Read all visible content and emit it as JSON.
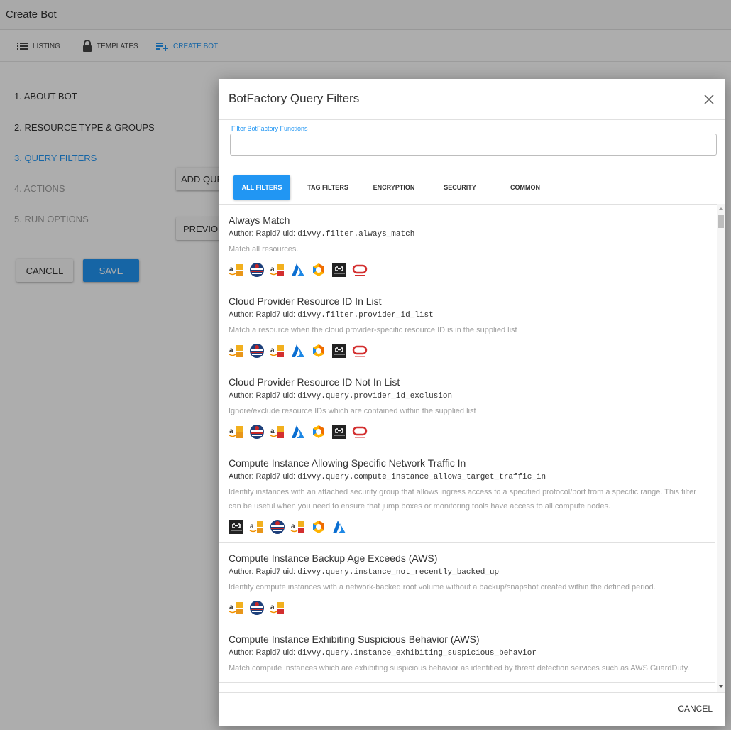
{
  "page": {
    "title": "Create Bot"
  },
  "nav": [
    {
      "label": "LISTING",
      "icon": "list-icon",
      "active": false
    },
    {
      "label": "TEMPLATES",
      "icon": "lock-icon",
      "active": false
    },
    {
      "label": "CREATE BOT",
      "icon": "playlist-add-icon",
      "active": true
    }
  ],
  "steps": [
    {
      "label": "1. ABOUT BOT",
      "state": "done"
    },
    {
      "label": "2. RESOURCE TYPE & GROUPS",
      "state": "done"
    },
    {
      "label": "3. QUERY FILTERS",
      "state": "current"
    },
    {
      "label": "4. ACTIONS",
      "state": "disabled"
    },
    {
      "label": "5. RUN OPTIONS",
      "state": "disabled"
    }
  ],
  "buttons": {
    "add_query": "ADD QUERY FILTER",
    "previous": "PREVIOUS",
    "cancel": "CANCEL",
    "save": "SAVE"
  },
  "modal": {
    "title": "BotFactory Query Filters",
    "filter_label": "Filter BotFactory Functions",
    "filter_value": "",
    "tabs": [
      "ALL FILTERS",
      "TAG FILTERS",
      "ENCRYPTION",
      "SECURITY",
      "COMMON"
    ],
    "active_tab": "ALL FILTERS",
    "footer_cancel": "CANCEL",
    "items": [
      {
        "title": "Always Match",
        "author": "Author: Rapid7",
        "uid_label": "uid:",
        "uid": "divvy.filter.always_match",
        "description": "Match all resources.",
        "icons": [
          "aws-icon",
          "aws-gov-icon",
          "aws-china-icon",
          "azure-icon",
          "gcp-icon",
          "alibaba-icon",
          "oracle-icon"
        ]
      },
      {
        "title": "Cloud Provider Resource ID In List",
        "author": "Author: Rapid7",
        "uid_label": "uid:",
        "uid": "divvy.filter.provider_id_list",
        "description": "Match a resource when the cloud provider-specific resource ID is in the supplied list",
        "icons": [
          "aws-icon",
          "aws-gov-icon",
          "aws-china-icon",
          "azure-icon",
          "gcp-icon",
          "alibaba-icon",
          "oracle-icon"
        ]
      },
      {
        "title": "Cloud Provider Resource ID Not In List",
        "author": "Author: Rapid7",
        "uid_label": "uid:",
        "uid": "divvy.query.provider_id_exclusion",
        "description": "Ignore/exclude resource IDs which are contained within the supplied list",
        "icons": [
          "aws-icon",
          "aws-gov-icon",
          "aws-china-icon",
          "azure-icon",
          "gcp-icon",
          "alibaba-icon",
          "oracle-icon"
        ]
      },
      {
        "title": "Compute Instance Allowing Specific Network Traffic In",
        "author": "Author: Rapid7",
        "uid_label": "uid:",
        "uid": "divvy.query.compute_instance_allows_target_traffic_in",
        "description": "Identify instances with an attached security group that allows ingress access to a specified protocol/port from a specific range. This filter can be useful when you need to ensure that jump boxes or monitoring tools have access to all compute nodes.",
        "icons": [
          "alibaba-icon",
          "aws-icon",
          "aws-gov-icon",
          "aws-china-icon",
          "gcp-icon",
          "azure-icon"
        ]
      },
      {
        "title": "Compute Instance Backup Age Exceeds (AWS)",
        "author": "Author: Rapid7",
        "uid_label": "uid:",
        "uid": "divvy.query.instance_not_recently_backed_up",
        "description": "Identify compute instances with a network-backed root volume without a backup/snapshot created within the defined period.",
        "icons": [
          "aws-icon",
          "aws-gov-icon",
          "aws-china-icon"
        ]
      },
      {
        "title": "Compute Instance Exhibiting Suspicious Behavior (AWS)",
        "author": "Author: Rapid7",
        "uid_label": "uid:",
        "uid": "divvy.query.instance_exhibiting_suspicious_behavior",
        "description": "Match compute instances which are exhibiting suspicious behavior as identified by threat detection services such as AWS GuardDuty.",
        "icons": []
      }
    ]
  },
  "colors": {
    "accent": "#2196f3",
    "overlay": "rgba(0,0,0,0.32)",
    "muted_text": "#9e9e9e"
  }
}
